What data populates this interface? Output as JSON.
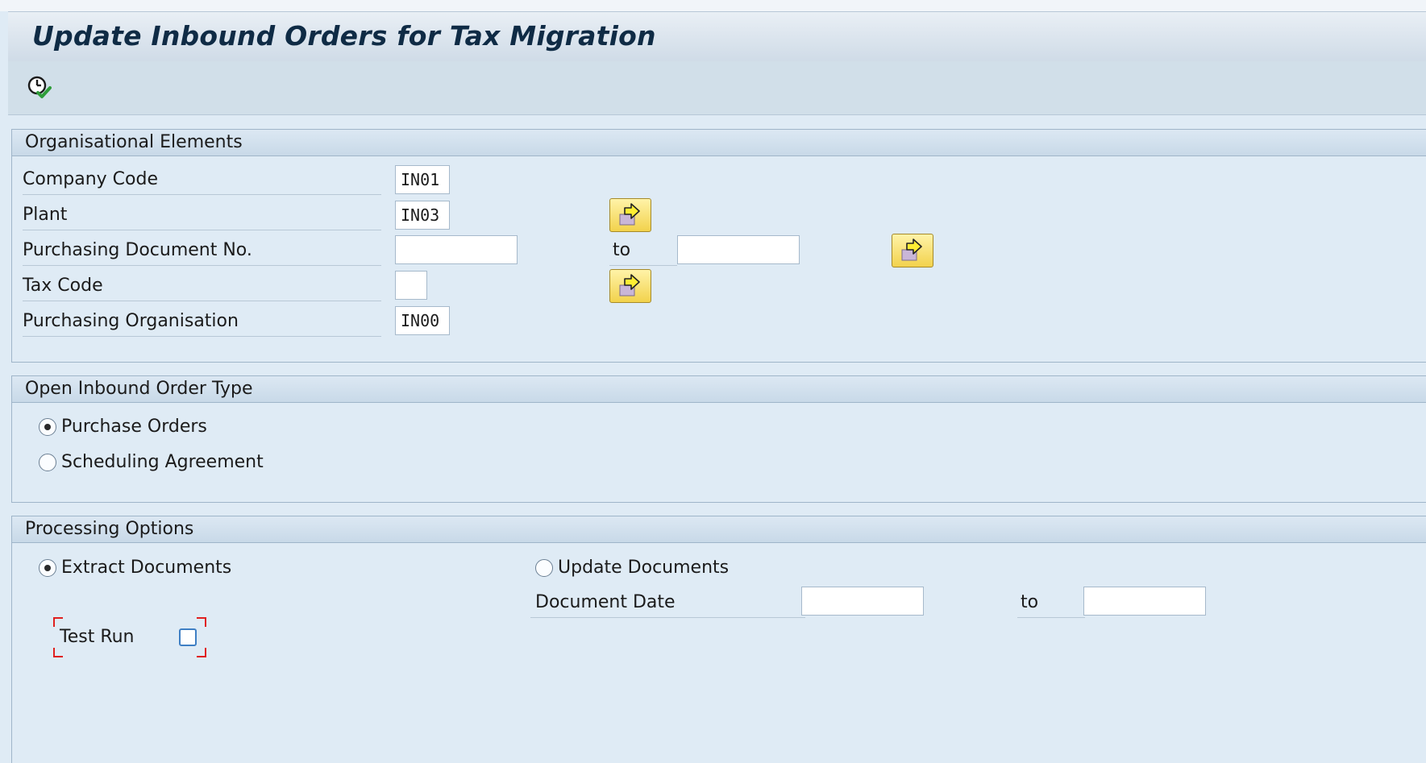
{
  "window": {
    "title": "Update Inbound Orders for Tax Migration"
  },
  "toolbar": {
    "execute_icon": "execute-clock-icon"
  },
  "org_group": {
    "title": "Organisational Elements",
    "company_code": {
      "label": "Company Code",
      "value": "IN01"
    },
    "plant": {
      "label": "Plant",
      "value": "IN03"
    },
    "purch_doc": {
      "label": "Purchasing Document No.",
      "from": "",
      "to_label": "to",
      "to": ""
    },
    "tax_code": {
      "label": "Tax Code",
      "value": ""
    },
    "purch_org": {
      "label": "Purchasing Organisation",
      "value": "IN00"
    }
  },
  "order_type_group": {
    "title": "Open Inbound Order Type",
    "options": [
      {
        "label": "Purchase Orders",
        "selected": true
      },
      {
        "label": "Scheduling Agreement",
        "selected": false
      }
    ]
  },
  "processing_group": {
    "title": "Processing Options",
    "extract": {
      "label": "Extract Documents",
      "selected": true
    },
    "update": {
      "label": "Update Documents",
      "selected": false
    },
    "doc_date": {
      "label": "Document Date",
      "from": "",
      "to_label": "to",
      "to": ""
    },
    "test_run": {
      "label": "Test Run",
      "checked": false
    }
  },
  "colors": {
    "background": "#dfebf5",
    "title_text": "#0f2b45",
    "button_yellow": "#f2d24c",
    "focus_red": "#e02020",
    "checkbox_blue": "#3f7fc4"
  }
}
